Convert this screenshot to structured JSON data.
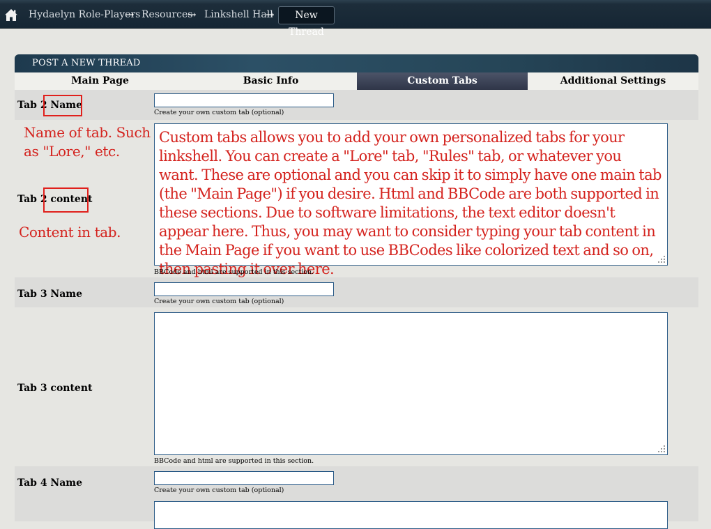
{
  "breadcrumb": {
    "items": [
      "Hydaelyn Role-Players",
      "Resources",
      "Linkshell Hall"
    ],
    "current": "New Thread",
    "separator": "→"
  },
  "panel": {
    "title": "POST A NEW THREAD"
  },
  "tabs": [
    {
      "label": "Main Page",
      "active": false
    },
    {
      "label": "Basic Info",
      "active": false
    },
    {
      "label": "Custom Tabs",
      "active": true
    },
    {
      "label": "Additional Settings",
      "active": false
    }
  ],
  "fields": {
    "tab2_name_label": "Tab 2 Name",
    "tab2_content_label": "Tab 2 content",
    "tab3_name_label": "Tab 3 Name",
    "tab3_content_label": "Tab 3 content",
    "tab4_name_label": "Tab 4 Name",
    "name_hint": "Create your own custom tab (optional)",
    "content_hint": "BBCode and html are supported in this section.",
    "tab2_content_value": "Custom tabs allows you to add your own personalized tabs for your linkshell. You can create a \"Lore\" tab, \"Rules\" tab, or whatever you want. These are optional and you can skip it to simply have one main tab (the \"Main Page\") if you desire. Html and BBCode are both supported in these sections. Due to software limitations, the text editor doesn't appear here. Thus, you may want to consider typing your tab content in the Main Page if you want to use BBCodes like colorized text and so on, then pasting it over here."
  },
  "annotations": {
    "name_note": "Name of tab. Such as \"Lore,\" etc.",
    "content_note": "Content in tab."
  },
  "colors": {
    "annotation_red": "#d4231e",
    "active_tab": "#3a4156",
    "input_border": "#2a5a86"
  }
}
